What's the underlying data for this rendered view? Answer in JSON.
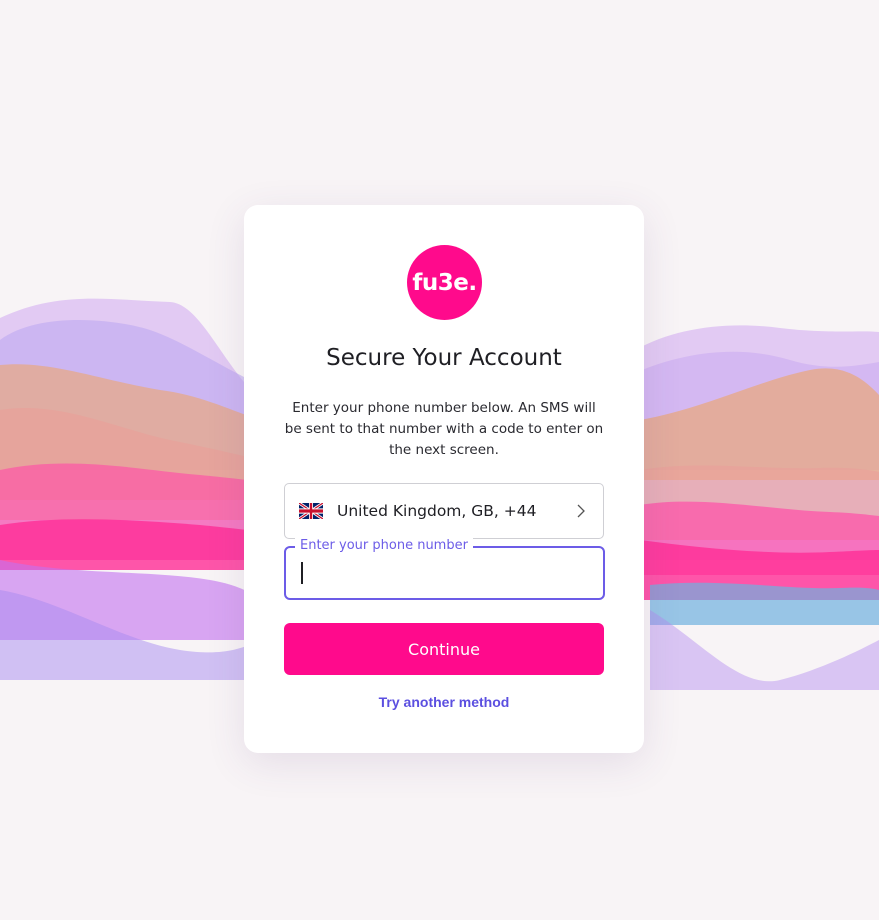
{
  "logo": {
    "text": "fu3e."
  },
  "card": {
    "title": "Secure Your Account",
    "description": "Enter your phone number below. An SMS will be sent to that number with a code to enter on the next screen."
  },
  "country_select": {
    "flag_icon": "uk-flag-icon",
    "label": "United Kingdom, GB, +44",
    "chevron_icon": "chevron-right-icon"
  },
  "phone_field": {
    "label": "Enter your phone number",
    "value": ""
  },
  "continue_button": {
    "label": "Continue"
  },
  "alt_link": {
    "label": "Try another method"
  },
  "colors": {
    "brand": "#ff0a8c",
    "accent": "#6c5ce7",
    "link": "#5b4fe0"
  }
}
